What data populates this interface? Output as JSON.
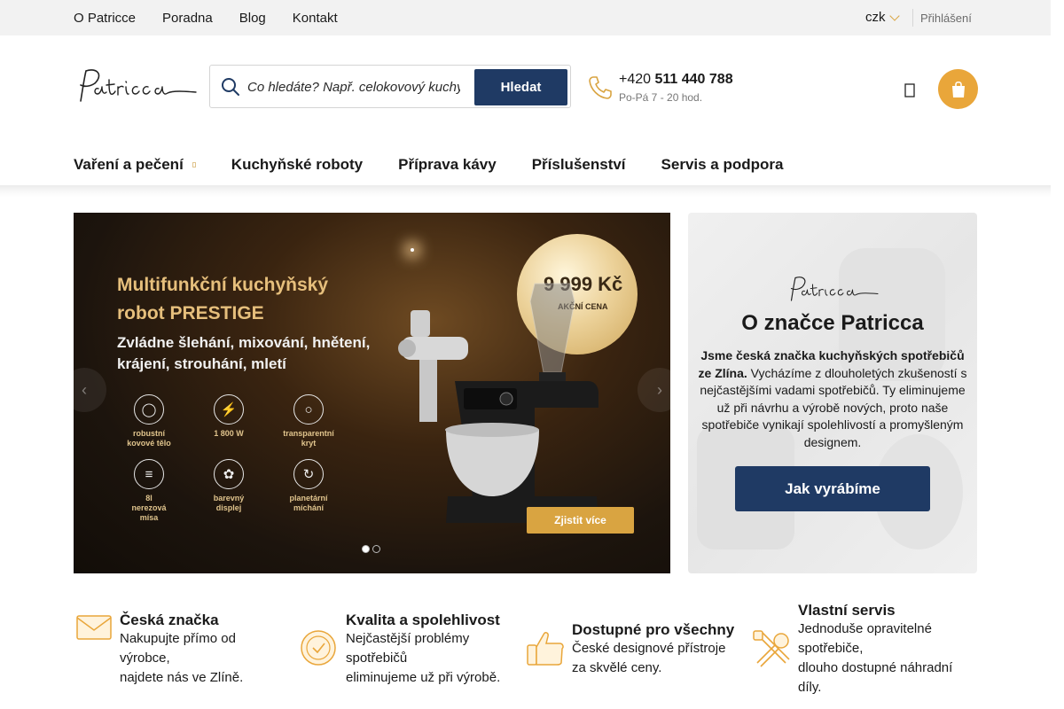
{
  "topbar": {
    "links": [
      "O Patricce",
      "Poradna",
      "Blog",
      "Kontakt"
    ],
    "currency": "czk",
    "login": "Přihlášení"
  },
  "header": {
    "search_placeholder": "Co hledáte? Např. celokovový kuchyňský robot",
    "search_button": "Hledat",
    "phone_prefix": "+420",
    "phone_number": "511 440 788",
    "phone_hours": "Po-Pá 7 - 20 hod."
  },
  "nav": {
    "items": [
      "Vaření a pečení",
      "Kuchyňské roboty",
      "Příprava kávy",
      "Příslušenství",
      "Servis a podpora"
    ]
  },
  "banner": {
    "title_line1": "Multifunkční kuchyňský",
    "title_line2": "robot PRESTIGE",
    "subtitle_line1": "Zvládne šlehání, mixování, hnětení,",
    "subtitle_line2": "krájení, strouhání, mletí",
    "features": [
      {
        "l1": "robustní",
        "l2": "kovové tělo",
        "l3": ""
      },
      {
        "l1": "1 800 W",
        "l2": "",
        "l3": ""
      },
      {
        "l1": "transparentní",
        "l2": "kryt",
        "l3": ""
      },
      {
        "l1": "8l",
        "l2": "nerezová",
        "l3": "mísa"
      },
      {
        "l1": "barevný",
        "l2": "displej",
        "l3": ""
      },
      {
        "l1": "planetární",
        "l2": "míchání",
        "l3": ""
      }
    ],
    "price": "9 999 Kč",
    "price_label": "AKČNÍ CENA",
    "cta": "Zjistit více",
    "slide_count": 2,
    "active_slide": 1
  },
  "about": {
    "heading": "O značce Patricca",
    "text_bold": "Jsme česká značka kuchyňských spotřebičů ze Zlína.",
    "text": " Vycházíme z dlouholetých zkušeností s nejčastějšími vadami spotřebičů. Ty eliminujeme už při návrhu a výrobě nových, proto naše spotřebiče vynikají spolehlivostí a promyšleným designem.",
    "button": "Jak vyrábíme"
  },
  "usps": [
    {
      "icon": "envelope-icon",
      "title": "Česká značka",
      "line1": "Nakupujte přímo od",
      "line2": "výrobce,",
      "line3": "najdete nás ve Zlíně.",
      "line4": ""
    },
    {
      "icon": "check-circle-icon",
      "title": "Kvalita a spolehlivost",
      "line1": "Nejčastější problémy",
      "line2": "spotřebičů",
      "line3": "eliminujeme už při výrobě.",
      "line4": ""
    },
    {
      "icon": "thumbs-up-icon",
      "title": "Dostupné pro všechny",
      "line1": "České designové přístroje",
      "line2": "za skvělé ceny.",
      "line3": "",
      "line4": ""
    },
    {
      "icon": "tools-icon",
      "title": "Vlastní servis",
      "line1": "Jednoduše opravitelné",
      "line2": "spotřebiče,",
      "line3": "dlouho dostupné náhradní",
      "line4": "díly."
    }
  ],
  "colors": {
    "primary": "#1f3a64",
    "accent": "#e9a63a",
    "gold": "#d9a441"
  }
}
